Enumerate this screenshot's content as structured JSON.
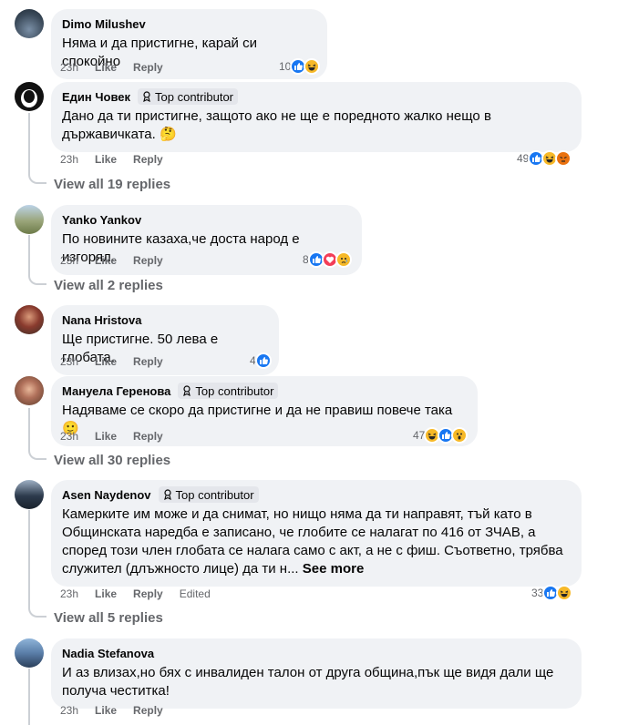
{
  "labels": {
    "like": "Like",
    "reply": "Reply",
    "edited": "Edited",
    "see_more": "See more",
    "top_contributor": "Top contributor"
  },
  "comments": [
    {
      "author": "Dimo Milushev",
      "text": "Няма и да пристигне, карай си спокойно",
      "time": "23h",
      "reactions_count": "10",
      "reaction_icons": [
        "like-icon",
        "haha-icon"
      ]
    },
    {
      "author": "Един Човек",
      "text": "Дано да ти пристигне, защото ако не ще е поредното жалко нещо в държавичката. 🤔",
      "time": "23h",
      "reactions_count": "49",
      "reaction_icons": [
        "like-icon",
        "haha-icon",
        "angry-icon"
      ],
      "view_replies": "View all 19 replies"
    },
    {
      "author": "Yanko Yankov",
      "text": "По новините казаха,че доста народ е изгорял.",
      "time": "23h",
      "reactions_count": "8",
      "reaction_icons": [
        "like-icon",
        "love-icon",
        "sad-icon"
      ],
      "view_replies": "View all 2 replies"
    },
    {
      "author": "Nana Hristova",
      "text": "Ще пристигне. 50 лева е глобата.",
      "time": "23h",
      "reactions_count": "4",
      "reaction_icons": [
        "like-icon"
      ]
    },
    {
      "author": "Мануела Геренова",
      "text": "Надяваме се скоро да пристигне и да не правиш повече така 🙂",
      "time": "23h",
      "reactions_count": "47",
      "reaction_icons": [
        "haha-icon",
        "like-icon",
        "wow-icon"
      ],
      "view_replies": "View all 30 replies"
    },
    {
      "author": "Asen Naydenov",
      "text": "Камерките им може и да снимат, но нищо няма да ти направят, тъй като в Общинската наредба е записано, че глобите се налагат по 416 от ЗЧАВ, а според този член глобата се налага само с акт, а не с фиш. Съответно, трябва служител (длъжносто лице) да ти н...",
      "time": "23h",
      "reactions_count": "33",
      "reaction_icons": [
        "like-icon",
        "haha-icon"
      ],
      "view_replies": "View all 5 replies"
    },
    {
      "author": "Nadia Stefanova",
      "text": "И аз влизах,но бях с инвалиден талон от друга община,пък ще видя дали ще получа честитка!",
      "time": "23h"
    }
  ],
  "colors": {
    "bubble": "#f0f2f5",
    "like": "#1877f2",
    "haha": "#f7b928",
    "angry": "#e9710f",
    "love": "#f33e58",
    "muted": "#65676b"
  }
}
